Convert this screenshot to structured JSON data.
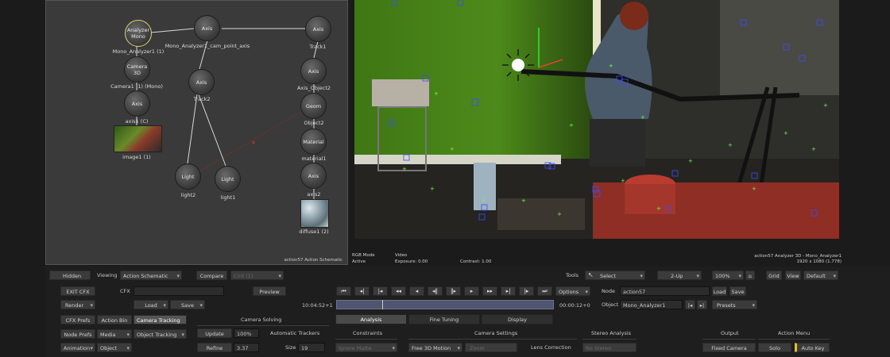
{
  "schematic": {
    "nodes": [
      {
        "id": "analyzer",
        "label": "Analyzer\nMono",
        "caption": "Mono_Analyzer1 (1)"
      },
      {
        "id": "axis_top",
        "label": "Axis",
        "caption": "Mono_Analyzer1_cam_point_axis"
      },
      {
        "id": "axis_track",
        "label": "Axis",
        "caption": "Track1"
      },
      {
        "id": "camera",
        "label": "Camera\n3D",
        "caption": "Camera1 (1) (Mono)"
      },
      {
        "id": "axis_c",
        "label": "Axis",
        "caption": "axis1 (C)"
      },
      {
        "id": "axis_track2",
        "label": "Axis",
        "caption": "Track2"
      },
      {
        "id": "axis_obj",
        "label": "Axis",
        "caption": "Axis_Object2"
      },
      {
        "id": "geom",
        "label": "Geom",
        "caption": "Object2"
      },
      {
        "id": "material",
        "label": "Material",
        "caption": "material1"
      },
      {
        "id": "axis2",
        "label": "Axis",
        "caption": "axis2"
      },
      {
        "id": "light2",
        "label": "Light",
        "caption": "light2"
      },
      {
        "id": "light1",
        "label": "Light",
        "caption": "light1"
      }
    ],
    "image_caption": "image1 (1)",
    "diffuse_caption": "diffuse1 (2)",
    "footer": "action57 Action Schematic"
  },
  "viewer": {
    "rgb_mode": "RGB Mode",
    "mode_value": "Video",
    "active": "Active",
    "exposure": "Exposure: 0.00",
    "contrast": "Contrast: 1.00",
    "title": "action57 Analyzer 3D - Mono_Analyzer1",
    "resolution": "1920 x 1080 (1.778)"
  },
  "toolbar": {
    "hidden": "Hidden",
    "viewing_label": "Viewing",
    "viewing_value": "Action Schematic",
    "compare": "Compare",
    "compare_value": "Clrd (1)",
    "tools_label": "Tools",
    "select": "Select",
    "layout": "2-Up",
    "zoom": "100%",
    "grid": "Grid",
    "view": "View",
    "default": "Default"
  },
  "row2": {
    "exit": "EXIT CFX",
    "cfx_label": "CFX",
    "preview": "Preview",
    "node_label": "Node",
    "node_value": "action57",
    "load": "Load",
    "save": "Save"
  },
  "row3": {
    "render": "Render",
    "load": "Load",
    "save": "Save",
    "timecode_in": "10:04:52+15",
    "timecode_out": "00:00:12+00",
    "object_label": "Object",
    "object_value": "Mono_Analyzer1",
    "presets": "Presets",
    "options": "Options"
  },
  "left_menu": {
    "cfx_prefs": "CFX Prefs",
    "action_bin": "Action Bin",
    "camera_tracking": "Camera Tracking",
    "node_prefs": "Node Prefs",
    "media": "Media",
    "object_tracking": "Object Tracking",
    "animation": "Animation",
    "object": "Object"
  },
  "tabs": {
    "analysis": "Analysis",
    "fine_tuning": "Fine Tuning",
    "display": "Display"
  },
  "camera_solving": {
    "title": "Camera Solving",
    "update": "Update",
    "update_pct": "100%",
    "refine": "Refine",
    "refine_val": "3.37",
    "auto_trackers": "Automatic Trackers",
    "size_label": "Size",
    "size_val": "19"
  },
  "constraints": {
    "title": "Constraints",
    "value": "Ignore Matte"
  },
  "camera_settings": {
    "title": "Camera Settings",
    "motion": "Free 3D Motion",
    "zoom": "Zoom",
    "lens": "Lens Correction"
  },
  "stereo": {
    "title": "Stereo Analysis",
    "value": "No Stereo"
  },
  "output": {
    "title": "Output",
    "fixed_camera": "Fixed Camera"
  },
  "action_menu": {
    "title": "Action Menu",
    "solo": "Solo",
    "auto_key": "Auto Key"
  },
  "colors": {
    "schematic_bg": "#3a3a3a",
    "panel_bg": "#1e1e1e",
    "selection": "#e2d36a",
    "tracker_blue": "#3b4cff",
    "tracker_green": "#6cff4c",
    "greenscreen": "#4d8a1a"
  }
}
